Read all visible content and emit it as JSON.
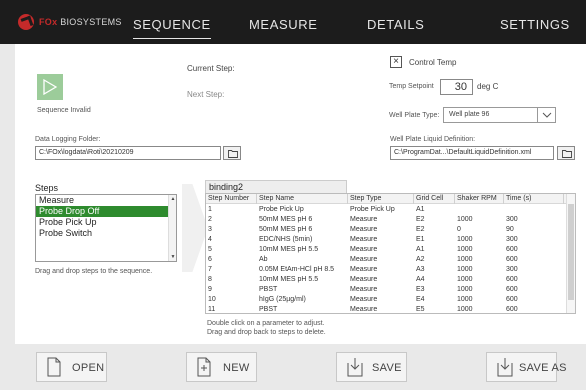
{
  "brand": {
    "fox": "FOx",
    "rest": " BIOSYSTEMS"
  },
  "nav": {
    "tabs": [
      {
        "label": "SEQUENCE",
        "active": true
      },
      {
        "label": "MEASURE",
        "active": false
      },
      {
        "label": "DETAILS",
        "active": false
      },
      {
        "label": "SETTINGS",
        "active": false
      }
    ]
  },
  "status": {
    "current_step_label": "Current Step:",
    "next_step_label": "Next Step:",
    "sequence_state": "Sequence Invalid"
  },
  "control": {
    "checkbox_mark": "×",
    "control_temp_label": "Control Temp",
    "temp_setpoint_label": "Temp Setpoint",
    "temp_setpoint_value": "30",
    "temp_unit": "deg C",
    "well_plate_type_label": "Well Plate Type:",
    "well_plate_type_value": "Well plate 96"
  },
  "logging": {
    "folder_label": "Data Logging Folder:",
    "folder_value": "C:\\FOx\\logdata\\Roti\\20210209"
  },
  "liquid": {
    "label": "Well Plate Liquid Definition:",
    "value": "C:\\ProgramDat...\\DefaultLiquidDefinition.xml"
  },
  "steps": {
    "heading": "Steps",
    "items": [
      {
        "label": "Measure",
        "selected": false
      },
      {
        "label": "Probe Drop Off",
        "selected": true
      },
      {
        "label": "Probe Pick Up",
        "selected": false
      },
      {
        "label": "Probe Switch",
        "selected": false
      }
    ],
    "hint": "Drag and drop steps to the sequence."
  },
  "sequence": {
    "name": "binding2",
    "columns": [
      "Step Number",
      "Step Name",
      "Step Type",
      "Grid Cell",
      "Shaker RPM",
      "Time (s)"
    ],
    "rows": [
      [
        "1",
        "Probe Pick Up",
        "Probe Pick Up",
        "A1",
        "",
        ""
      ],
      [
        "2",
        "50mM MES pH 6",
        "Measure",
        "E2",
        "1000",
        "300"
      ],
      [
        "3",
        "50mM MES pH 6",
        "Measure",
        "E2",
        "0",
        "90"
      ],
      [
        "4",
        "EDC/NHS (5min)",
        "Measure",
        "E1",
        "1000",
        "300"
      ],
      [
        "5",
        "10mM MES pH 5.5",
        "Measure",
        "A1",
        "1000",
        "600"
      ],
      [
        "6",
        "Ab",
        "Measure",
        "A2",
        "1000",
        "600"
      ],
      [
        "7",
        "0.05M EtAm-HCl pH 8.5",
        "Measure",
        "A3",
        "1000",
        "300"
      ],
      [
        "8",
        "10mM MES pH 5.5",
        "Measure",
        "A4",
        "1000",
        "600"
      ],
      [
        "9",
        "PBST",
        "Measure",
        "E3",
        "1000",
        "600"
      ],
      [
        "10",
        "hIgG (25µg/ml)",
        "Measure",
        "E4",
        "1000",
        "600"
      ],
      [
        "11",
        "PBST",
        "Measure",
        "E5",
        "1000",
        "600"
      ]
    ],
    "hint_line1": "Double click on a parameter to adjust.",
    "hint_line2": "Drag and drop back to steps to delete."
  },
  "toolbar": {
    "open_label": "OPEN",
    "new_label": "NEW",
    "save_label": "SAVE",
    "save_as_label": "SAVE AS"
  },
  "colors": {
    "topbar": "#1c1c1c",
    "brand_red": "#c42a2a",
    "selected_green": "#2e8b2e",
    "play_green": "#9ccc9a",
    "background": "#e9e9e9"
  }
}
